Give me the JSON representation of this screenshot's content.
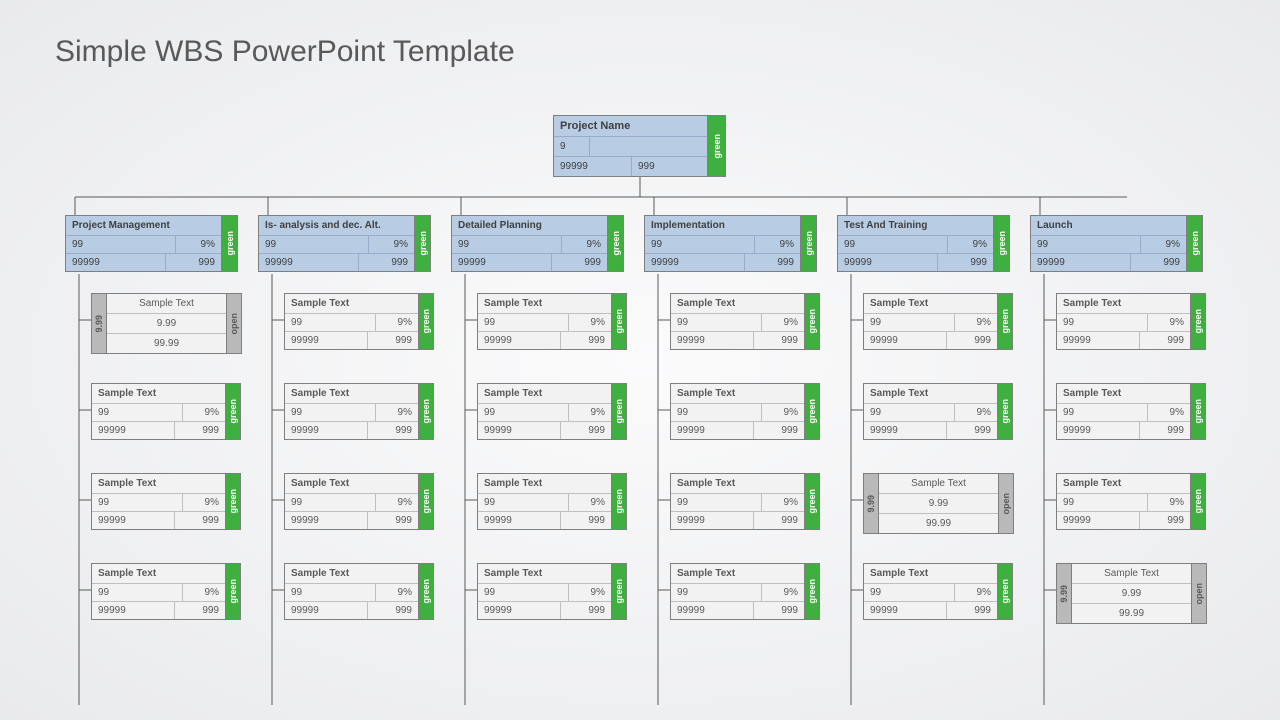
{
  "title": "Simple WBS PowerPoint Template",
  "root": {
    "title": "Project Name",
    "v1": "9",
    "v2": "99999",
    "v3": "999",
    "status": "green"
  },
  "branches": [
    {
      "title": "Project Management",
      "a": "99",
      "b": "9%",
      "c": "99999",
      "d": "999",
      "status": "green"
    },
    {
      "title": "Is- analysis and dec. Alt.",
      "a": "99",
      "b": "9%",
      "c": "99999",
      "d": "999",
      "status": "green"
    },
    {
      "title": "Detailed Planning",
      "a": "99",
      "b": "9%",
      "c": "99999",
      "d": "999",
      "status": "green"
    },
    {
      "title": "Implementation",
      "a": "99",
      "b": "9%",
      "c": "99999",
      "d": "999",
      "status": "green"
    },
    {
      "title": "Test And Training",
      "a": "99",
      "b": "9%",
      "c": "99999",
      "d": "999",
      "status": "green"
    },
    {
      "title": "Launch",
      "a": "99",
      "b": "9%",
      "c": "99999",
      "d": "999",
      "status": "green"
    }
  ],
  "leaves": [
    [
      {
        "type": "open",
        "title": "Sample Text",
        "l": "9.99",
        "v1": "9.99",
        "v2": "99.99",
        "r": "open"
      },
      {
        "type": "g",
        "title": "Sample Text",
        "a": "99",
        "b": "9%",
        "c": "99999",
        "d": "999",
        "status": "green"
      },
      {
        "type": "g",
        "title": "Sample Text",
        "a": "99",
        "b": "9%",
        "c": "99999",
        "d": "999",
        "status": "green"
      },
      {
        "type": "g",
        "title": "Sample Text",
        "a": "99",
        "b": "9%",
        "c": "99999",
        "d": "999",
        "status": "green"
      }
    ],
    [
      {
        "type": "g",
        "title": "Sample Text",
        "a": "99",
        "b": "9%",
        "c": "99999",
        "d": "999",
        "status": "green"
      },
      {
        "type": "g",
        "title": "Sample Text",
        "a": "99",
        "b": "9%",
        "c": "99999",
        "d": "999",
        "status": "green"
      },
      {
        "type": "g",
        "title": "Sample Text",
        "a": "99",
        "b": "9%",
        "c": "99999",
        "d": "999",
        "status": "green"
      },
      {
        "type": "g",
        "title": "Sample Text",
        "a": "99",
        "b": "9%",
        "c": "99999",
        "d": "999",
        "status": "green"
      }
    ],
    [
      {
        "type": "g",
        "title": "Sample Text",
        "a": "99",
        "b": "9%",
        "c": "99999",
        "d": "999",
        "status": "green"
      },
      {
        "type": "g",
        "title": "Sample Text",
        "a": "99",
        "b": "9%",
        "c": "99999",
        "d": "999",
        "status": "green"
      },
      {
        "type": "g",
        "title": "Sample Text",
        "a": "99",
        "b": "9%",
        "c": "99999",
        "d": "999",
        "status": "green"
      },
      {
        "type": "g",
        "title": "Sample Text",
        "a": "99",
        "b": "9%",
        "c": "99999",
        "d": "999",
        "status": "green"
      }
    ],
    [
      {
        "type": "g",
        "title": "Sample Text",
        "a": "99",
        "b": "9%",
        "c": "99999",
        "d": "999",
        "status": "green"
      },
      {
        "type": "g",
        "title": "Sample Text",
        "a": "99",
        "b": "9%",
        "c": "99999",
        "d": "999",
        "status": "green"
      },
      {
        "type": "g",
        "title": "Sample Text",
        "a": "99",
        "b": "9%",
        "c": "99999",
        "d": "999",
        "status": "green"
      },
      {
        "type": "g",
        "title": "Sample Text",
        "a": "99",
        "b": "9%",
        "c": "99999",
        "d": "999",
        "status": "green"
      }
    ],
    [
      {
        "type": "g",
        "title": "Sample Text",
        "a": "99",
        "b": "9%",
        "c": "99999",
        "d": "999",
        "status": "green"
      },
      {
        "type": "g",
        "title": "Sample Text",
        "a": "99",
        "b": "9%",
        "c": "99999",
        "d": "999",
        "status": "green"
      },
      {
        "type": "open",
        "title": "Sample Text",
        "l": "9.99",
        "v1": "9.99",
        "v2": "99.99",
        "r": "open"
      },
      {
        "type": "g",
        "title": "Sample Text",
        "a": "99",
        "b": "9%",
        "c": "99999",
        "d": "999",
        "status": "green"
      }
    ],
    [
      {
        "type": "g",
        "title": "Sample Text",
        "a": "99",
        "b": "9%",
        "c": "99999",
        "d": "999",
        "status": "green"
      },
      {
        "type": "g",
        "title": "Sample Text",
        "a": "99",
        "b": "9%",
        "c": "99999",
        "d": "999",
        "status": "green"
      },
      {
        "type": "g",
        "title": "Sample Text",
        "a": "99",
        "b": "9%",
        "c": "99999",
        "d": "999",
        "status": "green"
      },
      {
        "type": "open",
        "title": "Sample Text",
        "l": "9.99",
        "v1": "9.99",
        "v2": "99.99",
        "r": "open"
      }
    ]
  ]
}
